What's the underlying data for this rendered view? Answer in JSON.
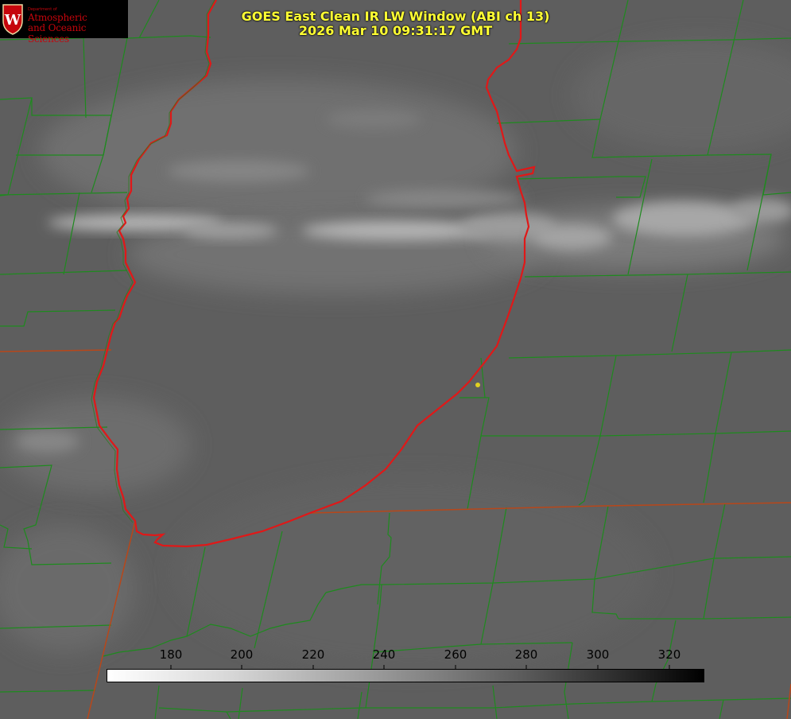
{
  "title": {
    "line1": "GOES East Clean IR LW Window (ABI ch 13)",
    "line2": "2026 Mar 10 09:31:17 GMT"
  },
  "logo": {
    "dept": "Department of",
    "line1": "Atmospheric",
    "line2": "and Oceanic Sciences",
    "seal_letter": "W",
    "brand_color": "#c5050c"
  },
  "colorbar": {
    "ticks": [
      "180",
      "200",
      "220",
      "240",
      "260",
      "280",
      "300",
      "320"
    ],
    "scale": "grayscale, white (cold) to black (warm)"
  },
  "colors": {
    "lake_shore": "#e02020",
    "county_lines": "#1e8a1e",
    "state_lines": "#b8471a",
    "title_text": "#ffff33",
    "marker": "#e0d020"
  }
}
